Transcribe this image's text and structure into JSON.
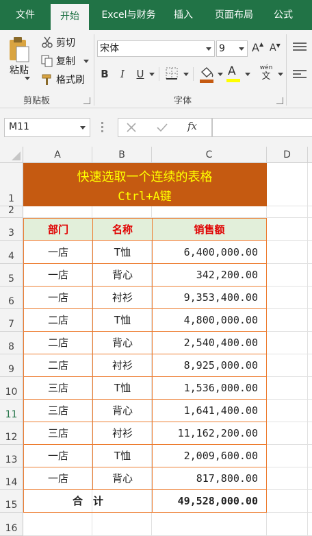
{
  "ribbon": {
    "tabs": [
      "文件",
      "开始",
      "Excel与财务",
      "插入",
      "页面布局",
      "公式"
    ],
    "active_tab": "开始",
    "clipboard": {
      "paste": "粘贴",
      "cut": "剪切",
      "copy": "复制",
      "format_painter": "格式刷",
      "group_label": "剪贴板"
    },
    "font": {
      "name": "宋体",
      "size": "9",
      "grow": "A",
      "shrink": "A",
      "bold": "B",
      "italic": "I",
      "underline": "U",
      "font_color_letter": "A",
      "phonetic_top": "wén",
      "phonetic_bottom": "文",
      "group_label": "字体"
    }
  },
  "formula_bar": {
    "name_box": "M11",
    "fx": "fx",
    "formula": ""
  },
  "columns": [
    "A",
    "B",
    "C",
    "D"
  ],
  "rows": [
    "1",
    "2",
    "3",
    "4",
    "5",
    "6",
    "7",
    "8",
    "9",
    "10",
    "11",
    "12",
    "13",
    "14",
    "15",
    "16"
  ],
  "selected_row": "11",
  "sheet": {
    "title_line1": "快速选取一个连续的表格",
    "title_line2": "Ctrl+A键",
    "headers": [
      "部门",
      "名称",
      "销售额"
    ],
    "data": [
      [
        "一店",
        "T恤",
        "6,400,000.00"
      ],
      [
        "一店",
        "背心",
        "342,200.00"
      ],
      [
        "一店",
        "衬衫",
        "9,353,400.00"
      ],
      [
        "二店",
        "T恤",
        "4,800,000.00"
      ],
      [
        "二店",
        "背心",
        "2,540,400.00"
      ],
      [
        "二店",
        "衬衫",
        "8,925,000.00"
      ],
      [
        "三店",
        "T恤",
        "1,536,000.00"
      ],
      [
        "三店",
        "背心",
        "1,641,400.00"
      ],
      [
        "三店",
        "衬衫",
        "11,162,200.00"
      ],
      [
        "一店",
        "T恤",
        "2,009,600.00"
      ],
      [
        "一店",
        "背心",
        "817,800.00"
      ]
    ],
    "total_label": "合　计",
    "total_value": "49,528,000.00"
  },
  "colors": {
    "excel_green": "#217346",
    "title_fill": "#c55a11",
    "title_text": "#ffff00",
    "header_fill": "#e2efda",
    "header_text": "#e00000",
    "table_border": "#ed7d31",
    "font_color_bar": "#ff0000",
    "highlight_bar": "#ffff00"
  }
}
